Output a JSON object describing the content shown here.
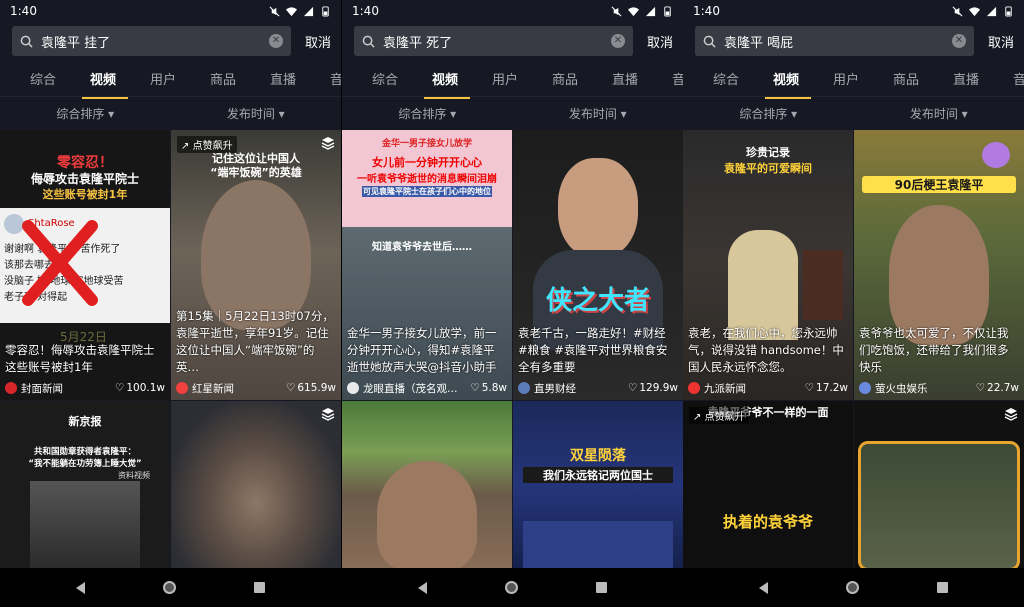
{
  "status": {
    "time": "1:40"
  },
  "tabs": [
    "综合",
    "视频",
    "用户",
    "商品",
    "直播",
    "音"
  ],
  "cancel_label": "取消",
  "sorts": [
    "综合排序 ▾",
    "发布时间 ▾"
  ],
  "badge_label": "点赞飙升",
  "panels": [
    {
      "query": "袁隆平 挂了",
      "cards": [
        {
          "headline1": "零容忍！",
          "headline2": "侮辱攻击袁隆平院士",
          "headline3": "这些账号被封1年",
          "comment_user": "ShtaRose",
          "comment_lines": [
            "谢谢啊 袁隆平 辛苦作死了",
            "该那去哪去",
            "没脑子 嫡 地球 害地球受苦",
            "老子不 对得起"
          ],
          "date_wm": "5月22日",
          "caption": "零容忍！侮辱攻击袁隆平院士这些账号被封1年",
          "author": "封面新闻",
          "likes": "100.1w"
        },
        {
          "headline1": "记住这位让中国人",
          "headline2": "“端牢饭碗”的英雄",
          "caption": "第15集｜5月22日13时07分，袁隆平逝世，享年91岁。记住这位让中国人“端牢饭碗”的英…",
          "author": "红星新闻",
          "likes": "615.9w"
        },
        {
          "headline1": "新京报",
          "headline2": "共和国勋章获得者袁隆平：",
          "headline3": "“我不能躺在功劳簿上睡大觉”",
          "tag": "资料视频"
        },
        {}
      ]
    },
    {
      "query": "袁隆平 死了",
      "cards": [
        {
          "headline1": "金华一男子接女儿放学",
          "headline2": "女儿前一分钟开开心心",
          "headline3": "一听袁爷爷逝世的消息瞬间泪崩",
          "headline4": "可见袁隆平院士在孩子们心中的地位",
          "headline5": "知道袁爷爷去世后……",
          "caption": "金华一男子接女儿放学，前一分钟开开心心，得知#袁隆平 逝世她放声大哭@抖音小助手",
          "author": "龙眼直播（茂名观…",
          "likes": "5.8w"
        },
        {
          "headline1": "侠之大者",
          "caption": "袁老千古，一路走好！#财经 #粮食 #袁隆平对世界粮食安全有多重要",
          "author": "直男财经",
          "likes": "129.9w"
        },
        {},
        {
          "headline1": "双星陨落",
          "headline2": "我们永远铭记两位国士"
        }
      ]
    },
    {
      "query": "袁隆平 喝屁",
      "cards": [
        {
          "headline1": "珍贵记录",
          "headline2": "袁隆平的可爱瞬间",
          "caption": "袁老，在我们心中，您永远帅气，说得没错 handsome！中国人民永远怀念您。",
          "author": "九派新闻",
          "likes": "17.2w"
        },
        {
          "headline1": "90后梗王袁隆平",
          "caption": "袁爷爷也太可爱了，不仅让我们吃饱饭，还带给了我们很多快乐",
          "author": "萤火虫娱乐",
          "likes": "22.7w"
        },
        {
          "headline1": "袁隆平爷爷不一样的一面",
          "headline2": "执着的袁爷爷"
        },
        {}
      ]
    }
  ]
}
